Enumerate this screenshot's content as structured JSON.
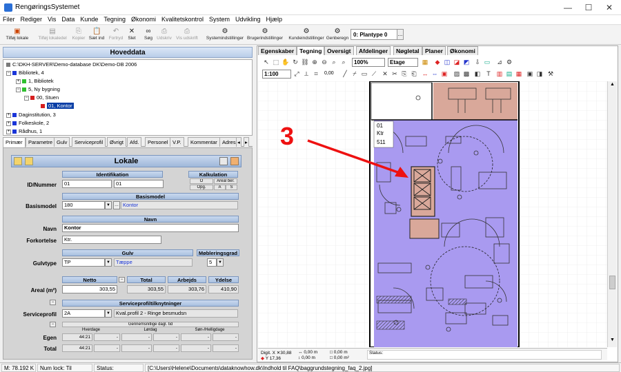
{
  "window": {
    "title": "RengøringsSystemet",
    "min": "—",
    "max": "☐",
    "close": "✕"
  },
  "menu": [
    "Filer",
    "Rediger",
    "Vis",
    "Data",
    "Kunde",
    "Tegning",
    "Økonomi",
    "Kvalitetskontrol",
    "System",
    "Udvikling",
    "Hjælp"
  ],
  "toolbar": {
    "tilfoej_lokale": "Tilføj lokale",
    "tilfoej_lokaledel": "Tilføj lokaledel",
    "kopier": "Kopier",
    "saet_ind": "Sæt ind",
    "fortryd": "Fortryd",
    "slet": "Slet",
    "soeg": "Søg",
    "udskriv": "Udskriv",
    "vis_udskrift": "Vis udskrift",
    "systemindstillinger": "Systemindstillinger",
    "brugerindstillinger": "Brugerindstillinger",
    "kundeindstillinger": "Kundeindstillinger",
    "genberegn": "Genberegn",
    "plantype": "0: Plantype 0",
    "dots": "..."
  },
  "left": {
    "header": "Hoveddata",
    "tree": {
      "root": "C:\\DKH-SERVER\\Demo-database DK\\Demo-DB 2006",
      "bibliotek": "Bibliotek, 4",
      "bibliotek_1": "1, Bibliotek",
      "ny_bygning": "5, Ny bygning",
      "stuen": "00, Stuen",
      "kontor": "01, Kontor",
      "daginstitution": "Daginstitution, 3",
      "folkeskole": "Folkeskole, 2",
      "raadhus": "Rådhus, 1"
    },
    "tabs": [
      "Primær",
      "Parametre",
      "Gulv",
      "Serviceprofil",
      "Øvrigt",
      "Afd.",
      "Personel",
      "V.P.",
      "Kommentar",
      "Adres"
    ],
    "form": {
      "title": "Lokale",
      "identifikation": "Identifikation",
      "kalkulation": "Kalkulation",
      "id_label": "ID/Nummer",
      "id1": "01",
      "id2": "01",
      "kalk_o": "O",
      "kalk_areal": "Areal ber.",
      "kalk_opg": "Opg.",
      "kalk_a": "A",
      "kalk_s": "S",
      "basismodel_head": "Basismodel",
      "basismodel_label": "Basismodel",
      "basismodel_code": "180",
      "basismodel_name": "Kontor",
      "navn_head": "Navn",
      "navn_label": "Navn",
      "navn": "Kontor",
      "forkortelse_label": "Forkortelse",
      "forkortelse": "Ktr.",
      "gulv_head": "Gulv",
      "moeblering_head": "Møbleringsgrad",
      "gulvtype_label": "Gulvtype",
      "gulv_code": "TP",
      "gulv_name": "Tæppe",
      "moeblering": "5",
      "netto_head": "Netto",
      "total_head": "Total",
      "arbejds_head": "Arbejds",
      "ydelse_head": "Ydelse",
      "areal_label": "Areal (m²)",
      "netto": "303,55",
      "total": "303,55",
      "arbejds": "303,76",
      "ydelse": "410,90",
      "svp_head": "Serviceprofiltilknytninger",
      "svp_label": "Serviceprofil",
      "svp_code": "2A",
      "svp_name": "Kval.profil 2 - Ringe besmudsn",
      "gns_head": "Gennemsnitlige dagl. tid",
      "hverdage": "Hverdage",
      "loerdag": "Lørdag",
      "soen": "Søn-/Helligdage",
      "egen_label": "Egen",
      "total_label": "Total",
      "egen_h": "44:21",
      "egen_l": "-",
      "egen_s": "-",
      "egen_x1": "-",
      "egen_x2": "-",
      "egen_x3": "-",
      "tot_h": "44:21",
      "tot_l": "-",
      "tot_s": "-",
      "tot_x1": "-",
      "tot_x2": "-",
      "tot_x3": "-"
    }
  },
  "right": {
    "tabs": [
      "Egenskaber",
      "Tegning",
      "Oversigt",
      "Afdelinger",
      "Nøgletal",
      "Planer",
      "Økonomi"
    ],
    "zoom": "100%",
    "etage": "Etage",
    "scale": "1:100",
    "offset": "0,00",
    "annotation": "3",
    "room_label": {
      "num": "01",
      "abbr": "Ktr",
      "area": "511"
    },
    "info": {
      "x_label": "Digit. X",
      "x": "30,88",
      "y_label": "Y",
      "y": "17,36",
      "d1": "0,00 m",
      "d2": "0,00 m",
      "d3": "0,00 m",
      "d4": "0,00 m²",
      "status": "Status:"
    }
  },
  "status": {
    "mem": "M: 78.192 K",
    "numlock": "Num lock: Til",
    "status_label": "Status:",
    "path": "[C:\\Users\\Helene\\Documents\\dataknowhow.dk\\Indhold til FAQ\\baggrundstegning_faq_2.jpg]"
  },
  "colors": {
    "room_fill": "#a99af0",
    "room_pink": "#d9a89a",
    "arrow": "#e11",
    "tree_blue": "#1a35d8",
    "tree_green": "#2fbf2f",
    "tree_red": "#d61f1f"
  }
}
